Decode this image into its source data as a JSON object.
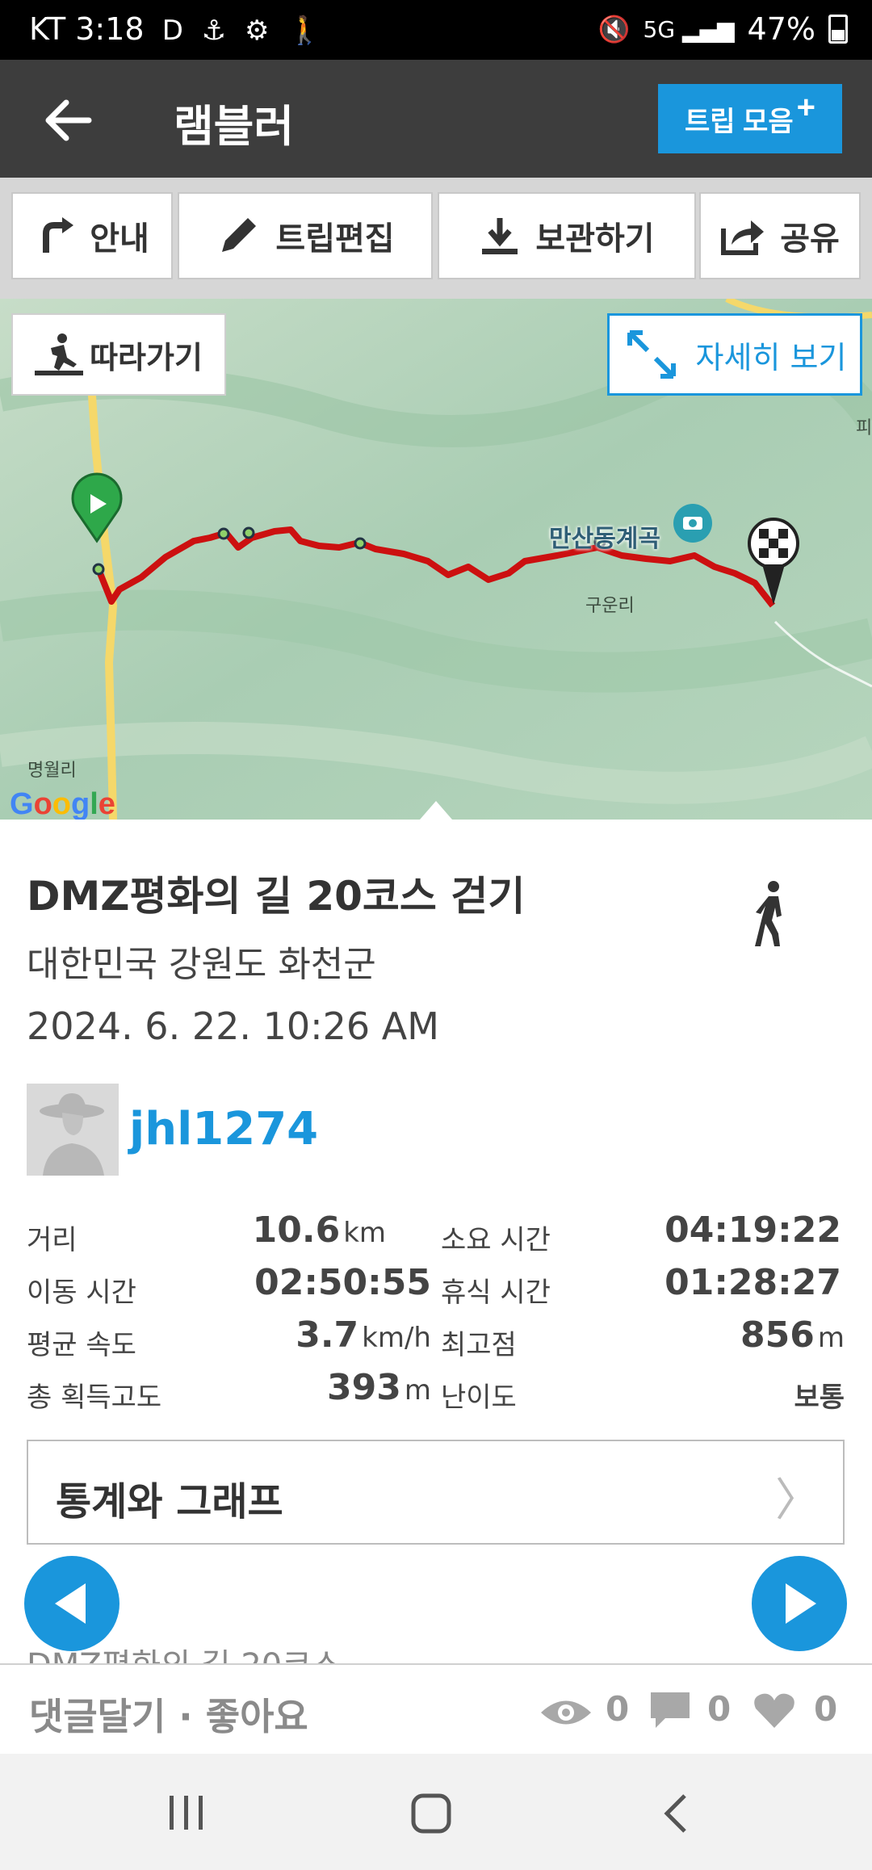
{
  "status_bar": {
    "carrier_time": "KT 3:18",
    "icons": "D ⚓ ⚙ 🚶",
    "battery": "47%"
  },
  "app_bar": {
    "title": "램블러",
    "collection_button": "트립 모음",
    "collection_plus": "+"
  },
  "toolbar": {
    "guide": "안내",
    "edit_trip": "트립편집",
    "save": "보관하기",
    "share": "공유"
  },
  "map": {
    "follow_button": "따라가기",
    "detail_button": "자세히 보기",
    "labels": {
      "place_1": "만산동계곡",
      "place_2": "구운리",
      "place_3": "명월리",
      "edge": "피"
    },
    "logo": "Google"
  },
  "trip": {
    "title": "DMZ평화의 길 20코스 걷기",
    "location": "대한민국 강원도 화천군",
    "datetime": "2024. 6. 22. 10:26 AM",
    "username": "jhl1274"
  },
  "stats": {
    "distance_label": "거리",
    "distance_value": "10.6",
    "distance_unit": "km",
    "total_time_label": "소요 시간",
    "total_time_value": "04:19:22",
    "moving_time_label": "이동 시간",
    "moving_time_value": "02:50:55",
    "rest_time_label": "휴식 시간",
    "rest_time_value": "01:28:27",
    "avg_speed_label": "평균 속도",
    "avg_speed_value": "3.7",
    "avg_speed_unit": "km/h",
    "max_alt_label": "최고점",
    "max_alt_value": "856",
    "max_alt_unit": "m",
    "gain_label": "총 획득고도",
    "gain_value": "393",
    "gain_unit": "m",
    "difficulty_label": "난이도",
    "difficulty_value": "보통"
  },
  "stats_graph_button": "통계와 그래프",
  "next_peek": "DMZ평화의 길 20코스",
  "bottom": {
    "comment_like": "댓글달기 · 좋아요",
    "views": "0",
    "comments": "0",
    "likes": "0"
  },
  "colors": {
    "accent": "#1a96dc",
    "app_bar": "#3d3d3d",
    "route": "#cc1010"
  }
}
